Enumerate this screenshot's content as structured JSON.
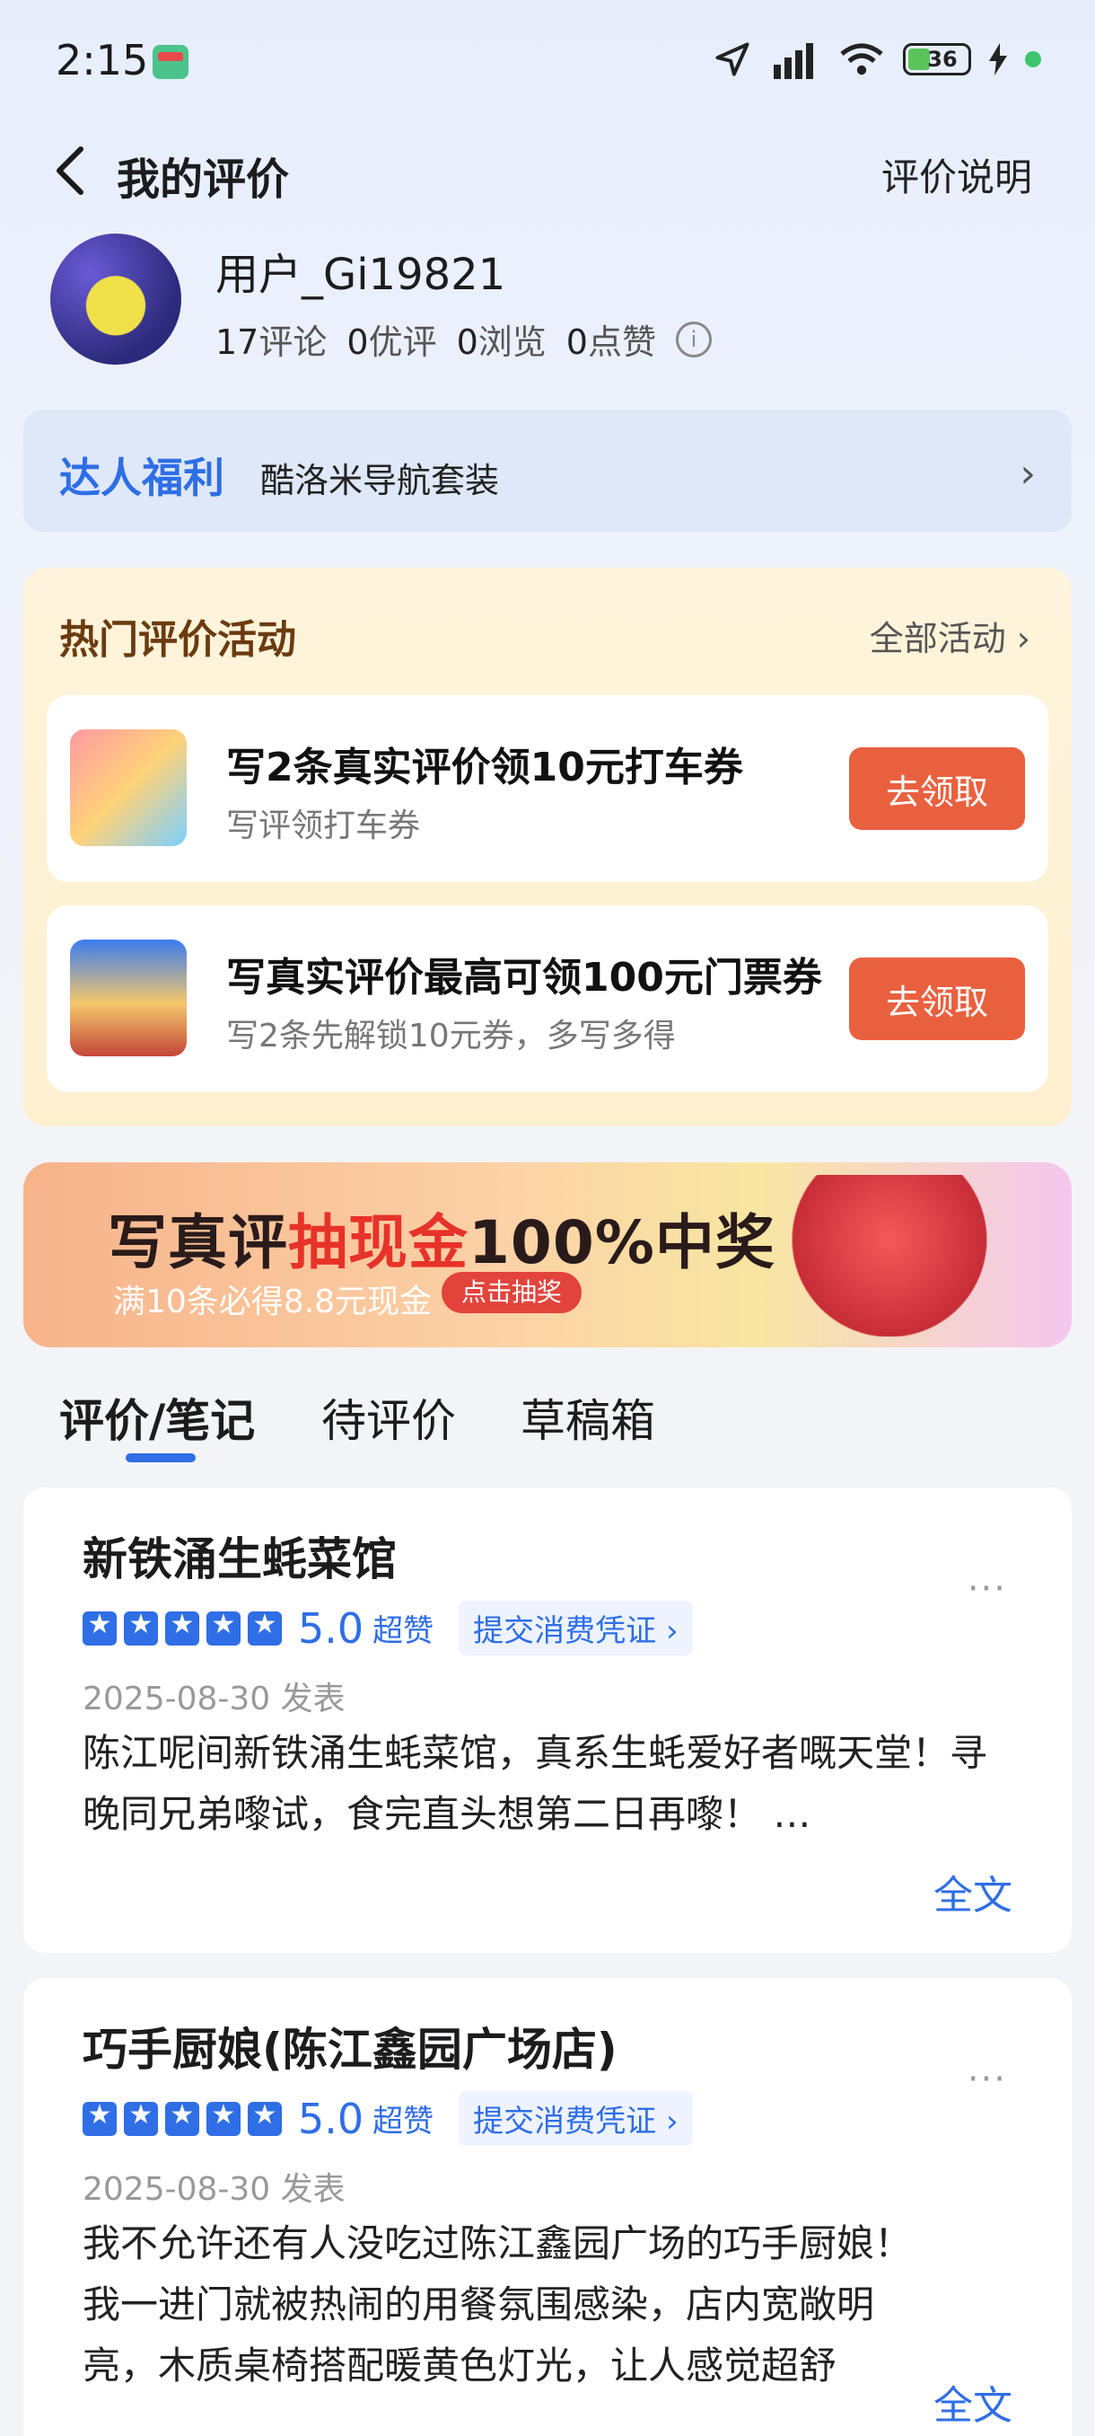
{
  "status_bar": {
    "time": "2:15",
    "battery_level": "36",
    "colors": {
      "battery": "#5ac45a",
      "charge_dot": "#3ec46d"
    }
  },
  "header": {
    "title": "我的评价",
    "help_link": "评价说明"
  },
  "profile": {
    "username": "用户_Gi19821",
    "stats": {
      "reviews_count": "17",
      "reviews_label": "评论",
      "quality_count": "0",
      "quality_label": "优评",
      "views_count": "0",
      "views_label": "浏览",
      "likes_count": "0",
      "likes_label": "点赞"
    }
  },
  "expert_benefits": {
    "title": "达人福利",
    "description": "酷洛米导航套装"
  },
  "activities": {
    "title": "热门评价活动",
    "all_link": "全部活动",
    "items": [
      {
        "title": "写2条真实评价领10元打车券",
        "subtitle": "写评领打车券",
        "button": "去领取"
      },
      {
        "title": "写真实评价最高可领100元门票券",
        "subtitle": "写2条先解锁10元券，多写多得",
        "button": "去领取"
      }
    ]
  },
  "banner": {
    "title_part1": "写真评",
    "title_part2": "抽现金",
    "title_part3": "100%中奖",
    "subtitle": "满10条必得8.8元现金",
    "button": "点击抽奖"
  },
  "tabs": [
    {
      "label": "评价/笔记",
      "active": true
    },
    {
      "label": "待评价",
      "active": false
    },
    {
      "label": "草稿箱",
      "active": false
    }
  ],
  "reviews": [
    {
      "shop": "新铁涌生蚝菜馆",
      "stars": 5,
      "score": "5.0",
      "score_label": "超赞",
      "voucher_link": "提交消费凭证 ›",
      "date": "2025-08-30 发表",
      "text": "陈江呢间新铁涌生蚝菜馆，真系生蚝爱好者嘅天堂！寻晚同兄弟嚟试，食完直头想第二日再嚟！ …",
      "more": "···",
      "full_text_link": "全文"
    },
    {
      "shop": "巧手厨娘(陈江鑫园广场店)",
      "stars": 5,
      "score": "5.0",
      "score_label": "超赞",
      "voucher_link": "提交消费凭证 ›",
      "date": "2025-08-30 发表",
      "text": "我不允许还有人没吃过陈江鑫园广场的巧手厨娘！我一进门就被热闹的用餐氛围感染，店内宽敞明亮，木质桌椅搭配暖黄色灯光，让人感觉超舒",
      "more": "···",
      "full_text_link": "全文"
    }
  ],
  "colors": {
    "accent": "#2f6ee5",
    "claim_button": "#e9603f",
    "activity_title": "#6b3b10"
  }
}
